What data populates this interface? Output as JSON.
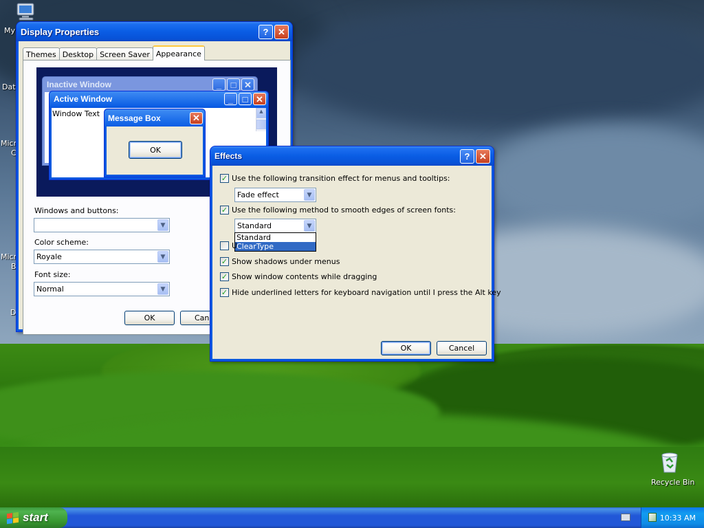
{
  "desktop": {
    "icons": [
      {
        "id": "my-computer",
        "label": "My"
      },
      {
        "id": "data",
        "label": "Dat"
      },
      {
        "id": "micro1",
        "label": "Micro"
      },
      {
        "id": "micro1b",
        "label": "C"
      },
      {
        "id": "micro2",
        "label": "Micro"
      },
      {
        "id": "micro2b",
        "label": "B"
      },
      {
        "id": "d",
        "label": "D"
      }
    ],
    "recycle_bin": "Recycle Bin"
  },
  "display_properties": {
    "title": "Display Properties",
    "tabs": [
      {
        "label": "Themes",
        "active": false
      },
      {
        "label": "Desktop",
        "active": false
      },
      {
        "label": "Screen Saver",
        "active": false
      },
      {
        "label": "Appearance",
        "active": true
      }
    ],
    "preview": {
      "inactive_title": "Inactive Window",
      "active_title": "Active Window",
      "window_text": "Window Text",
      "message_box_title": "Message Box",
      "message_box_ok": "OK"
    },
    "windows_and_buttons_label": "Windows and buttons:",
    "windows_and_buttons_value": "",
    "color_scheme_label": "Color scheme:",
    "color_scheme_value": "Royale",
    "font_size_label": "Font size:",
    "font_size_value": "Normal",
    "ok_label": "OK",
    "cancel_label": "Canc"
  },
  "effects": {
    "title": "Effects",
    "transition_label": "Use the following transition effect for menus and tooltips:",
    "transition_checked": true,
    "transition_value": "Fade effect",
    "smooth_label": "Use the following method to smooth edges of screen fonts:",
    "smooth_checked": true,
    "smooth_value": "Standard",
    "smooth_options": [
      "Standard",
      "ClearType"
    ],
    "smooth_selected": "ClearType",
    "hidden_option_label": "U",
    "hidden_option_checked": false,
    "shadows_label": "Show shadows under menus",
    "shadows_checked": true,
    "drag_label": "Show window contents while dragging",
    "drag_checked": true,
    "underline_label": "Hide underlined letters for keyboard navigation until I press the Alt key",
    "underline_checked": true,
    "ok_label": "OK",
    "cancel_label": "Cancel"
  },
  "taskbar": {
    "start_label": "start",
    "clock": "10:33 AM"
  },
  "colors": {
    "xp_blue": "#0a58e0",
    "start_green": "#37962f",
    "dialog_bg": "#ece9d8",
    "selection": "#316ac5"
  }
}
